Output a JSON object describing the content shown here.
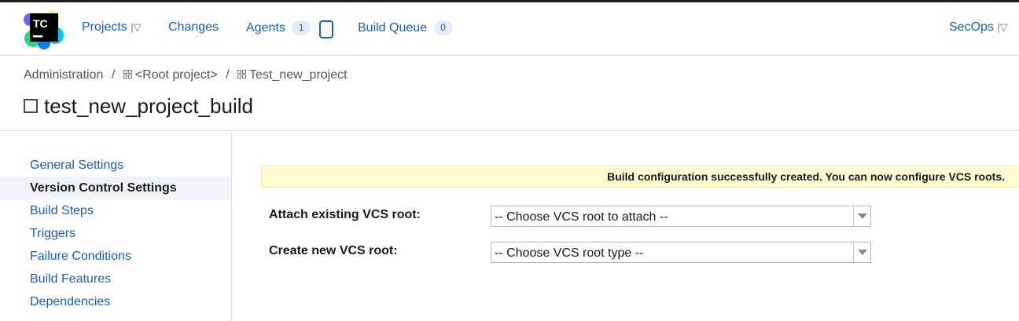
{
  "header": {
    "logo_text": "TC",
    "nav": {
      "projects": "Projects",
      "changes": "Changes",
      "agents": "Agents",
      "agents_count": "1",
      "build_queue": "Build Queue",
      "build_queue_count": "0"
    },
    "user": "SecOps",
    "caret": "|▽"
  },
  "breadcrumb": {
    "items": [
      "Administration",
      "<Root project>",
      "Test_new_project"
    ],
    "separator": "/"
  },
  "page": {
    "title": "test_new_project_build"
  },
  "sidebar": {
    "items": [
      {
        "label": "General Settings",
        "active": false
      },
      {
        "label": "Version Control Settings",
        "active": true
      },
      {
        "label": "Build Steps",
        "active": false
      },
      {
        "label": "Triggers",
        "active": false
      },
      {
        "label": "Failure Conditions",
        "active": false
      },
      {
        "label": "Build Features",
        "active": false
      },
      {
        "label": "Dependencies",
        "active": false
      }
    ]
  },
  "content": {
    "banner": "Build configuration successfully created. You can now configure VCS roots.",
    "attach": {
      "label": "Attach existing VCS root:",
      "value": "-- Choose VCS root to attach --"
    },
    "create": {
      "label": "Create new VCS root:",
      "value": "-- Choose VCS root type --"
    }
  },
  "colors": {
    "link": "#1e5eb0",
    "banner_bg": "#fdfbd2",
    "active_bg": "#f0f4fa"
  }
}
